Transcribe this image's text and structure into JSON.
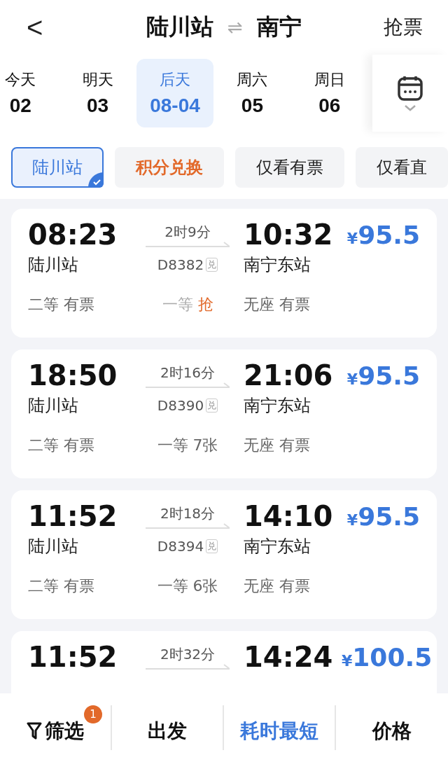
{
  "header": {
    "back": "<",
    "from": "陆川站",
    "swap": "⇌",
    "to": "南宁",
    "action": "抢票"
  },
  "dates": [
    {
      "day": "今天",
      "date": "02",
      "selected": false
    },
    {
      "day": "明天",
      "date": "03",
      "selected": false
    },
    {
      "day": "后天",
      "date": "08-04",
      "selected": true
    },
    {
      "day": "周六",
      "date": "05",
      "selected": false
    },
    {
      "day": "周日",
      "date": "06",
      "selected": false
    }
  ],
  "filters": [
    {
      "label": "陆川站",
      "kind": "station",
      "selected": true
    },
    {
      "label": "积分兑换",
      "kind": "promo",
      "selected": false
    },
    {
      "label": "仅看有票",
      "kind": "plain",
      "selected": false
    },
    {
      "label": "仅看直",
      "kind": "plain",
      "selected": false
    }
  ],
  "trains": [
    {
      "depart": "08:23",
      "from": "陆川站",
      "duration": "2时9分",
      "number": "D8382",
      "badge": "兑",
      "arrive": "10:32",
      "to": "南宁东站",
      "currency": "¥",
      "price": "95.5",
      "seats": [
        {
          "class": "二等",
          "status": "有票",
          "kind": "available"
        },
        {
          "class": "一等",
          "status": "抢",
          "kind": "grab"
        },
        {
          "class": "无座",
          "status": "有票",
          "kind": "available"
        }
      ]
    },
    {
      "depart": "18:50",
      "from": "陆川站",
      "duration": "2时16分",
      "number": "D8390",
      "badge": "兑",
      "arrive": "21:06",
      "to": "南宁东站",
      "currency": "¥",
      "price": "95.5",
      "seats": [
        {
          "class": "二等",
          "status": "有票",
          "kind": "available"
        },
        {
          "class": "一等",
          "status": "7张",
          "kind": "available"
        },
        {
          "class": "无座",
          "status": "有票",
          "kind": "available"
        }
      ]
    },
    {
      "depart": "11:52",
      "from": "陆川站",
      "duration": "2时18分",
      "number": "D8394",
      "badge": "兑",
      "arrive": "14:10",
      "to": "南宁东站",
      "currency": "¥",
      "price": "95.5",
      "seats": [
        {
          "class": "二等",
          "status": "有票",
          "kind": "available"
        },
        {
          "class": "一等",
          "status": "6张",
          "kind": "available"
        },
        {
          "class": "无座",
          "status": "有票",
          "kind": "available"
        }
      ]
    },
    {
      "depart": "11:52",
      "duration": "2时32分",
      "arrive": "14:24",
      "currency": "¥",
      "price": "100.5"
    }
  ],
  "bottom_bar": [
    {
      "label": "筛选",
      "kind": "filter",
      "badge": "1",
      "selected": false
    },
    {
      "label": "出发",
      "kind": "sort",
      "selected": false
    },
    {
      "label": "耗时最短",
      "kind": "sort",
      "selected": true
    },
    {
      "label": "价格",
      "kind": "sort",
      "selected": false
    }
  ]
}
